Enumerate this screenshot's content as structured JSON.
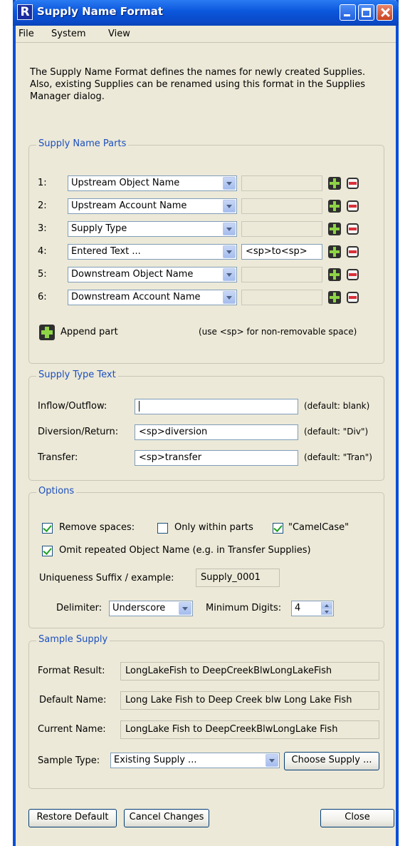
{
  "window": {
    "title": "Supply Name Format"
  },
  "menu": {
    "file": "File",
    "system": "System",
    "view": "View"
  },
  "intro": "The Supply Name Format defines the names for newly created Supplies.  Also, existing Supplies can be renamed using this format in the Supplies Manager dialog.",
  "parts": {
    "legend": "Supply Name Parts",
    "rows": [
      {
        "num": "1:",
        "value": "Upstream Object Name",
        "text": ""
      },
      {
        "num": "2:",
        "value": "Upstream Account Name",
        "text": ""
      },
      {
        "num": "3:",
        "value": "Supply Type",
        "text": ""
      },
      {
        "num": "4:",
        "value": "Entered Text ...",
        "text": "<sp>to<sp>"
      },
      {
        "num": "5:",
        "value": "Downstream Object Name",
        "text": ""
      },
      {
        "num": "6:",
        "value": "Downstream Account Name",
        "text": ""
      }
    ],
    "append_label": "Append part",
    "hint": "(use <sp> for non-removable space)"
  },
  "type_text": {
    "legend": "Supply Type Text",
    "inflow_label": "Inflow/Outflow:",
    "inflow_value": "",
    "inflow_default": "(default: blank)",
    "diversion_label": "Diversion/Return:",
    "diversion_value": "<sp>diversion",
    "diversion_default": "(default: \"Div\")",
    "transfer_label": "Transfer:",
    "transfer_value": "<sp>transfer",
    "transfer_default": "(default: \"Tran\")"
  },
  "options": {
    "legend": "Options",
    "remove_spaces": "Remove spaces:",
    "only_within_parts": "Only within parts",
    "camel_case": "\"CamelCase\"",
    "omit_repeated": "Omit repeated Object Name (e.g. in Transfer Supplies)",
    "suffix_label": "Uniqueness Suffix / example:",
    "suffix_example": "Supply_0001",
    "delimiter_label": "Delimiter:",
    "delimiter_value": "Underscore",
    "min_digits_label": "Minimum Digits:",
    "min_digits_value": "4"
  },
  "sample": {
    "legend": "Sample Supply",
    "format_label": "Format Result:",
    "format_value": "LongLakeFish to DeepCreekBlwLongLakeFish",
    "default_label": "Default Name:",
    "default_value": "Long Lake Fish to Deep Creek blw Long Lake Fish",
    "current_label": "Current Name:",
    "current_value": "LongLake Fish to DeepCreekBlwLongLake Fish",
    "type_label": "Sample Type:",
    "type_value": "Existing Supply ...",
    "choose_button": "Choose Supply ..."
  },
  "footer": {
    "restore": "Restore Default",
    "cancel": "Cancel Changes",
    "close": "Close"
  }
}
